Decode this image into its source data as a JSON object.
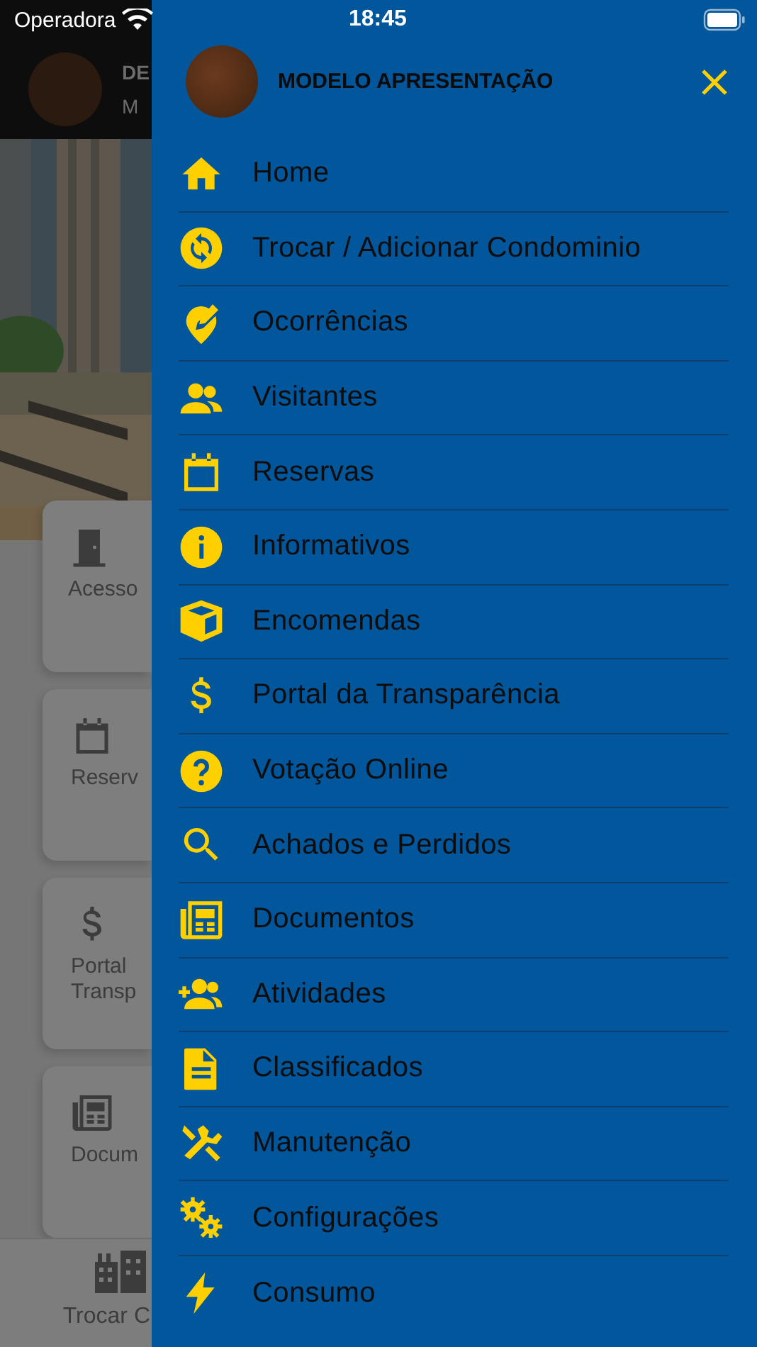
{
  "status_bar": {
    "carrier": "Operadora",
    "time": "18:45"
  },
  "background": {
    "header": {
      "line_1": "DE",
      "line_2": "M"
    },
    "cards": [
      {
        "lines": [
          "Acesso"
        ]
      },
      {
        "lines": [
          "Reserv"
        ]
      },
      {
        "lines": [
          "Portal",
          "Transp"
        ]
      },
      {
        "lines": [
          "Docum"
        ]
      }
    ],
    "tab_bar": {
      "label": "Trocar C"
    }
  },
  "drawer": {
    "title": "MODELO APRESENTAÇÃO",
    "items": [
      {
        "label": "Home"
      },
      {
        "label": "Trocar / Adicionar Condominio"
      },
      {
        "label": "Ocorrências"
      },
      {
        "label": "Visitantes"
      },
      {
        "label": "Reservas"
      },
      {
        "label": "Informativos"
      },
      {
        "label": "Encomendas"
      },
      {
        "label": "Portal da Transparência"
      },
      {
        "label": "Votação Online"
      },
      {
        "label": "Achados e Perdidos"
      },
      {
        "label": "Documentos"
      },
      {
        "label": "Atividades"
      },
      {
        "label": "Classificados"
      },
      {
        "label": "Manutenção"
      },
      {
        "label": "Configurações"
      },
      {
        "label": "Consumo"
      }
    ]
  }
}
